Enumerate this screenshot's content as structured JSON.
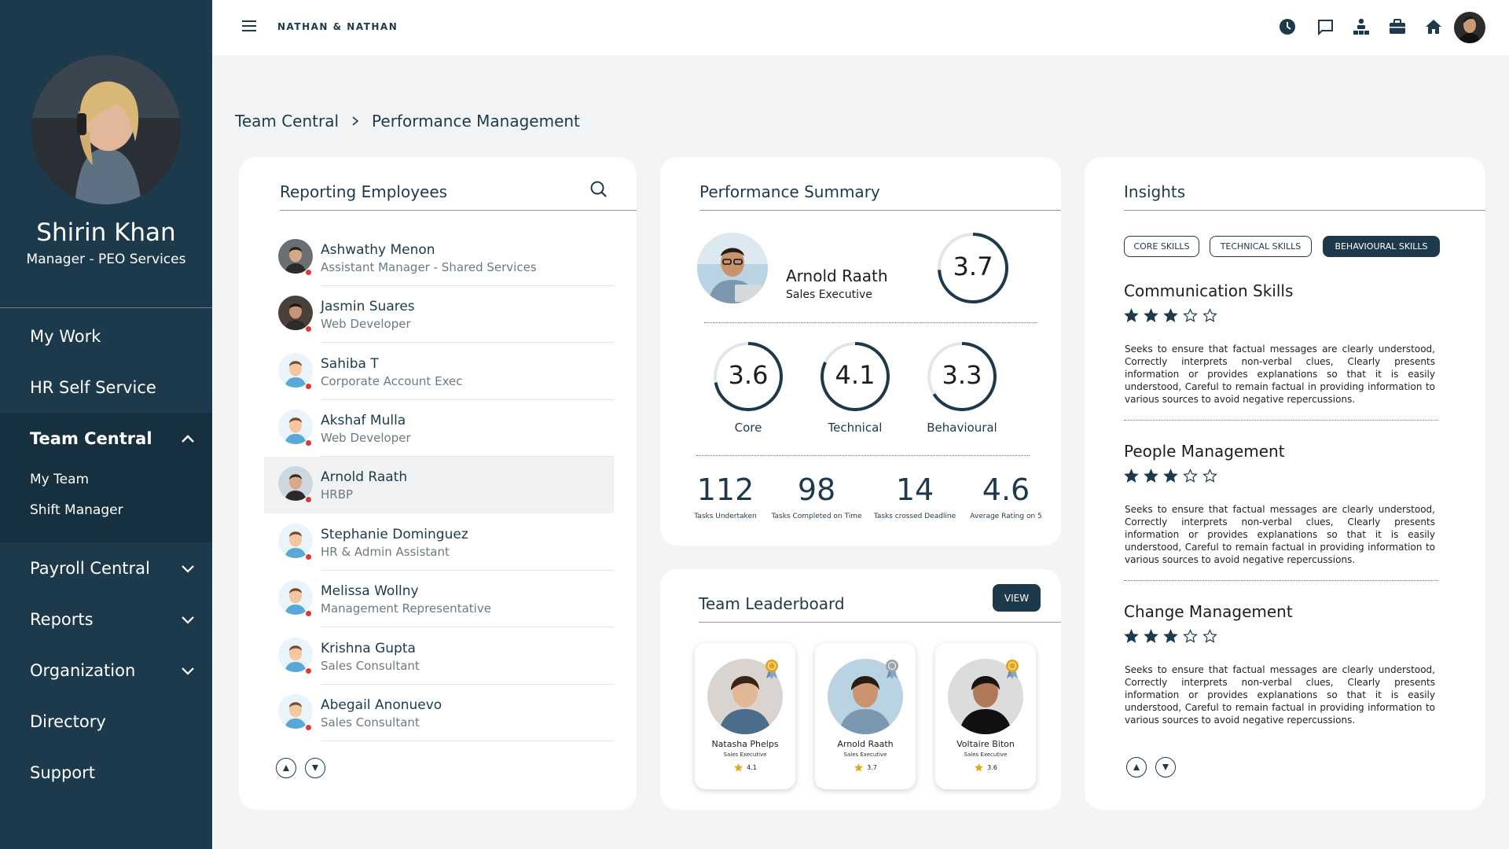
{
  "sidebar": {
    "profile_name": "Shirin Khan",
    "profile_role": "Manager - PEO Services",
    "items": [
      {
        "label": "My Work"
      },
      {
        "label": "HR Self Service"
      }
    ],
    "group": {
      "label": "Team Central",
      "sub": [
        "My Team",
        "Shift Manager"
      ]
    },
    "items_after": [
      {
        "label": "Payroll Central"
      },
      {
        "label": "Reports"
      },
      {
        "label": "Organization"
      },
      {
        "label": "Directory"
      },
      {
        "label": "Support"
      }
    ]
  },
  "topbar": {
    "brand": "NATHAN & NATHAN",
    "icons": [
      "clock-icon",
      "chat-icon",
      "org-chart-icon",
      "briefcase-icon",
      "home-icon"
    ]
  },
  "breadcrumb": {
    "root": "Team Central",
    "current": "Performance Management"
  },
  "employees": {
    "title": "Reporting Employees",
    "list": [
      {
        "name": "Ashwathy Menon",
        "role": "Assistant Manager - Shared Services"
      },
      {
        "name": "Jasmin Suares",
        "role": "Web Developer"
      },
      {
        "name": "Sahiba T",
        "role": "Corporate Account Exec"
      },
      {
        "name": "Akshaf Mulla",
        "role": "Web Developer"
      },
      {
        "name": "Arnold Raath",
        "role": "HRBP"
      },
      {
        "name": "Stephanie Dominguez",
        "role": "HR & Admin Assistant"
      },
      {
        "name": "Melissa Wollny",
        "role": "Management Representative"
      },
      {
        "name": "Krishna Gupta",
        "role": "Sales Consultant"
      },
      {
        "name": "Abegail Anonuevo",
        "role": "Sales Consultant"
      }
    ]
  },
  "summary": {
    "title": "Performance Summary",
    "person_name": "Arnold Raath",
    "person_role": "Sales Executive",
    "overall": "3.7",
    "overall_fraction": 0.74,
    "rings": [
      {
        "value": "3.6",
        "label": "Core",
        "fraction": 0.72
      },
      {
        "value": "4.1",
        "label": "Technical",
        "fraction": 0.82
      },
      {
        "value": "3.3",
        "label": "Behavioural",
        "fraction": 0.66
      }
    ],
    "stats": [
      {
        "value": "112",
        "label": "Tasks Undertaken"
      },
      {
        "value": "98",
        "label": "Tasks Completed on Time"
      },
      {
        "value": "14",
        "label": "Tasks crossed Deadline"
      },
      {
        "value": "4.6",
        "label": "Average Rating on 5"
      }
    ]
  },
  "leaderboard": {
    "title": "Team Leaderboard",
    "view_label": "VIEW",
    "people": [
      {
        "name": "Natasha Phelps",
        "role": "Sales Executive",
        "score": "4.1"
      },
      {
        "name": "Arnold Raath",
        "role": "Sales Executive",
        "score": "3.7"
      },
      {
        "name": "Voltaire Biton",
        "role": "Sales Executive",
        "score": "3.6"
      }
    ]
  },
  "insights": {
    "title": "Insights",
    "chips": [
      "CORE SKILLS",
      "TECHNICAL SKILLS",
      "BEHAVIOURAL SKILLS"
    ],
    "active_chip": "BEHAVIOURAL SKILLS",
    "items": [
      {
        "title": "Communication Skills",
        "rating": 3,
        "max": 5,
        "desc": "Seeks to ensure that factual messages are clearly understood, Correctly interprets non-verbal clues, Clearly presents information or provides explanations so that it is easily understood, Careful to remain factual in providing information to various sources to avoid negative repercussions."
      },
      {
        "title": "People Management",
        "rating": 3,
        "max": 5,
        "desc": "Seeks to ensure that factual messages are clearly understood, Correctly interprets non-verbal clues, Clearly presents information or provides explanations so that it is easily understood, Careful to remain factual in providing information to various sources to avoid negative repercussions."
      },
      {
        "title": "Change Management",
        "rating": 3,
        "max": 5,
        "desc": "Seeks to ensure that factual messages are clearly understood, Correctly interprets non-verbal clues, Clearly presents information or provides explanations so that it is easily understood, Careful to remain factual in providing information to various sources to avoid negative repercussions."
      }
    ]
  },
  "colors": {
    "primary": "#1d3a4c",
    "status_red": "#e03636",
    "star": "#1d3a4c",
    "gold": "#e8a317"
  }
}
